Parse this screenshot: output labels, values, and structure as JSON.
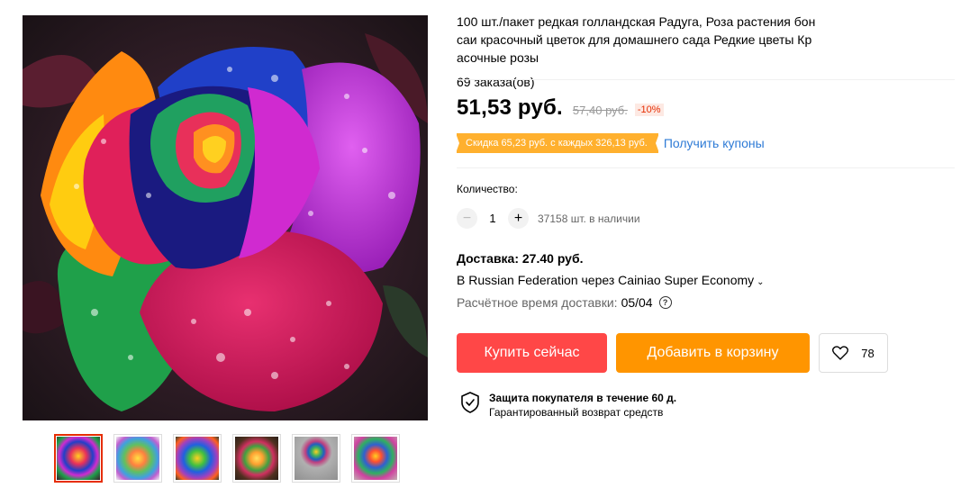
{
  "product": {
    "title": "100 шт./пакет редкая голландская Радуга, Роза растения бонсаи красочный цветок для домашнего сада Редкие цветы Красочные розы",
    "orders": "69 заказа(ов)"
  },
  "gallery": {
    "main_image": "rainbow-rose-photo",
    "thumbnails": [
      {
        "name": "rainbow-rose-thumb-1",
        "active": true
      },
      {
        "name": "rainbow-rose-thumb-2",
        "active": false
      },
      {
        "name": "rainbow-rose-thumb-3",
        "active": false
      },
      {
        "name": "rainbow-rose-thumb-4",
        "active": false
      },
      {
        "name": "rainbow-rose-thumb-5",
        "active": false
      },
      {
        "name": "rainbow-rose-thumb-6",
        "active": false
      }
    ]
  },
  "pricing": {
    "price": "51,53 руб.",
    "old_price": "57,40 руб.",
    "discount": "-10%",
    "coupon_text": "Скидка 65,23 руб. с каждых 326,13 руб.",
    "coupon_link": "Получить купоны"
  },
  "quantity": {
    "label": "Количество:",
    "minus": "−",
    "plus": "+",
    "value": "1",
    "stock": "37158 шт. в наличии"
  },
  "shipping": {
    "title": "Доставка: 27.40 руб.",
    "method": "В Russian Federation через Cainiao Super Economy",
    "time_label": "Расчётное время доставки:",
    "time_value": "05/04",
    "help": "?"
  },
  "actions": {
    "buy_now": "Купить сейчас",
    "add_to_cart": "Добавить в корзину",
    "wishlist_count": "78"
  },
  "protection": {
    "title": "Защита покупателя в течение 60 д.",
    "subtitle": "Гарантированный возврат средств"
  },
  "colors": {
    "buy": "#ff4747",
    "cart": "#ff9500",
    "coupon": "#ffb02e",
    "link": "#2e7bd6",
    "discount": "#e62e04"
  }
}
